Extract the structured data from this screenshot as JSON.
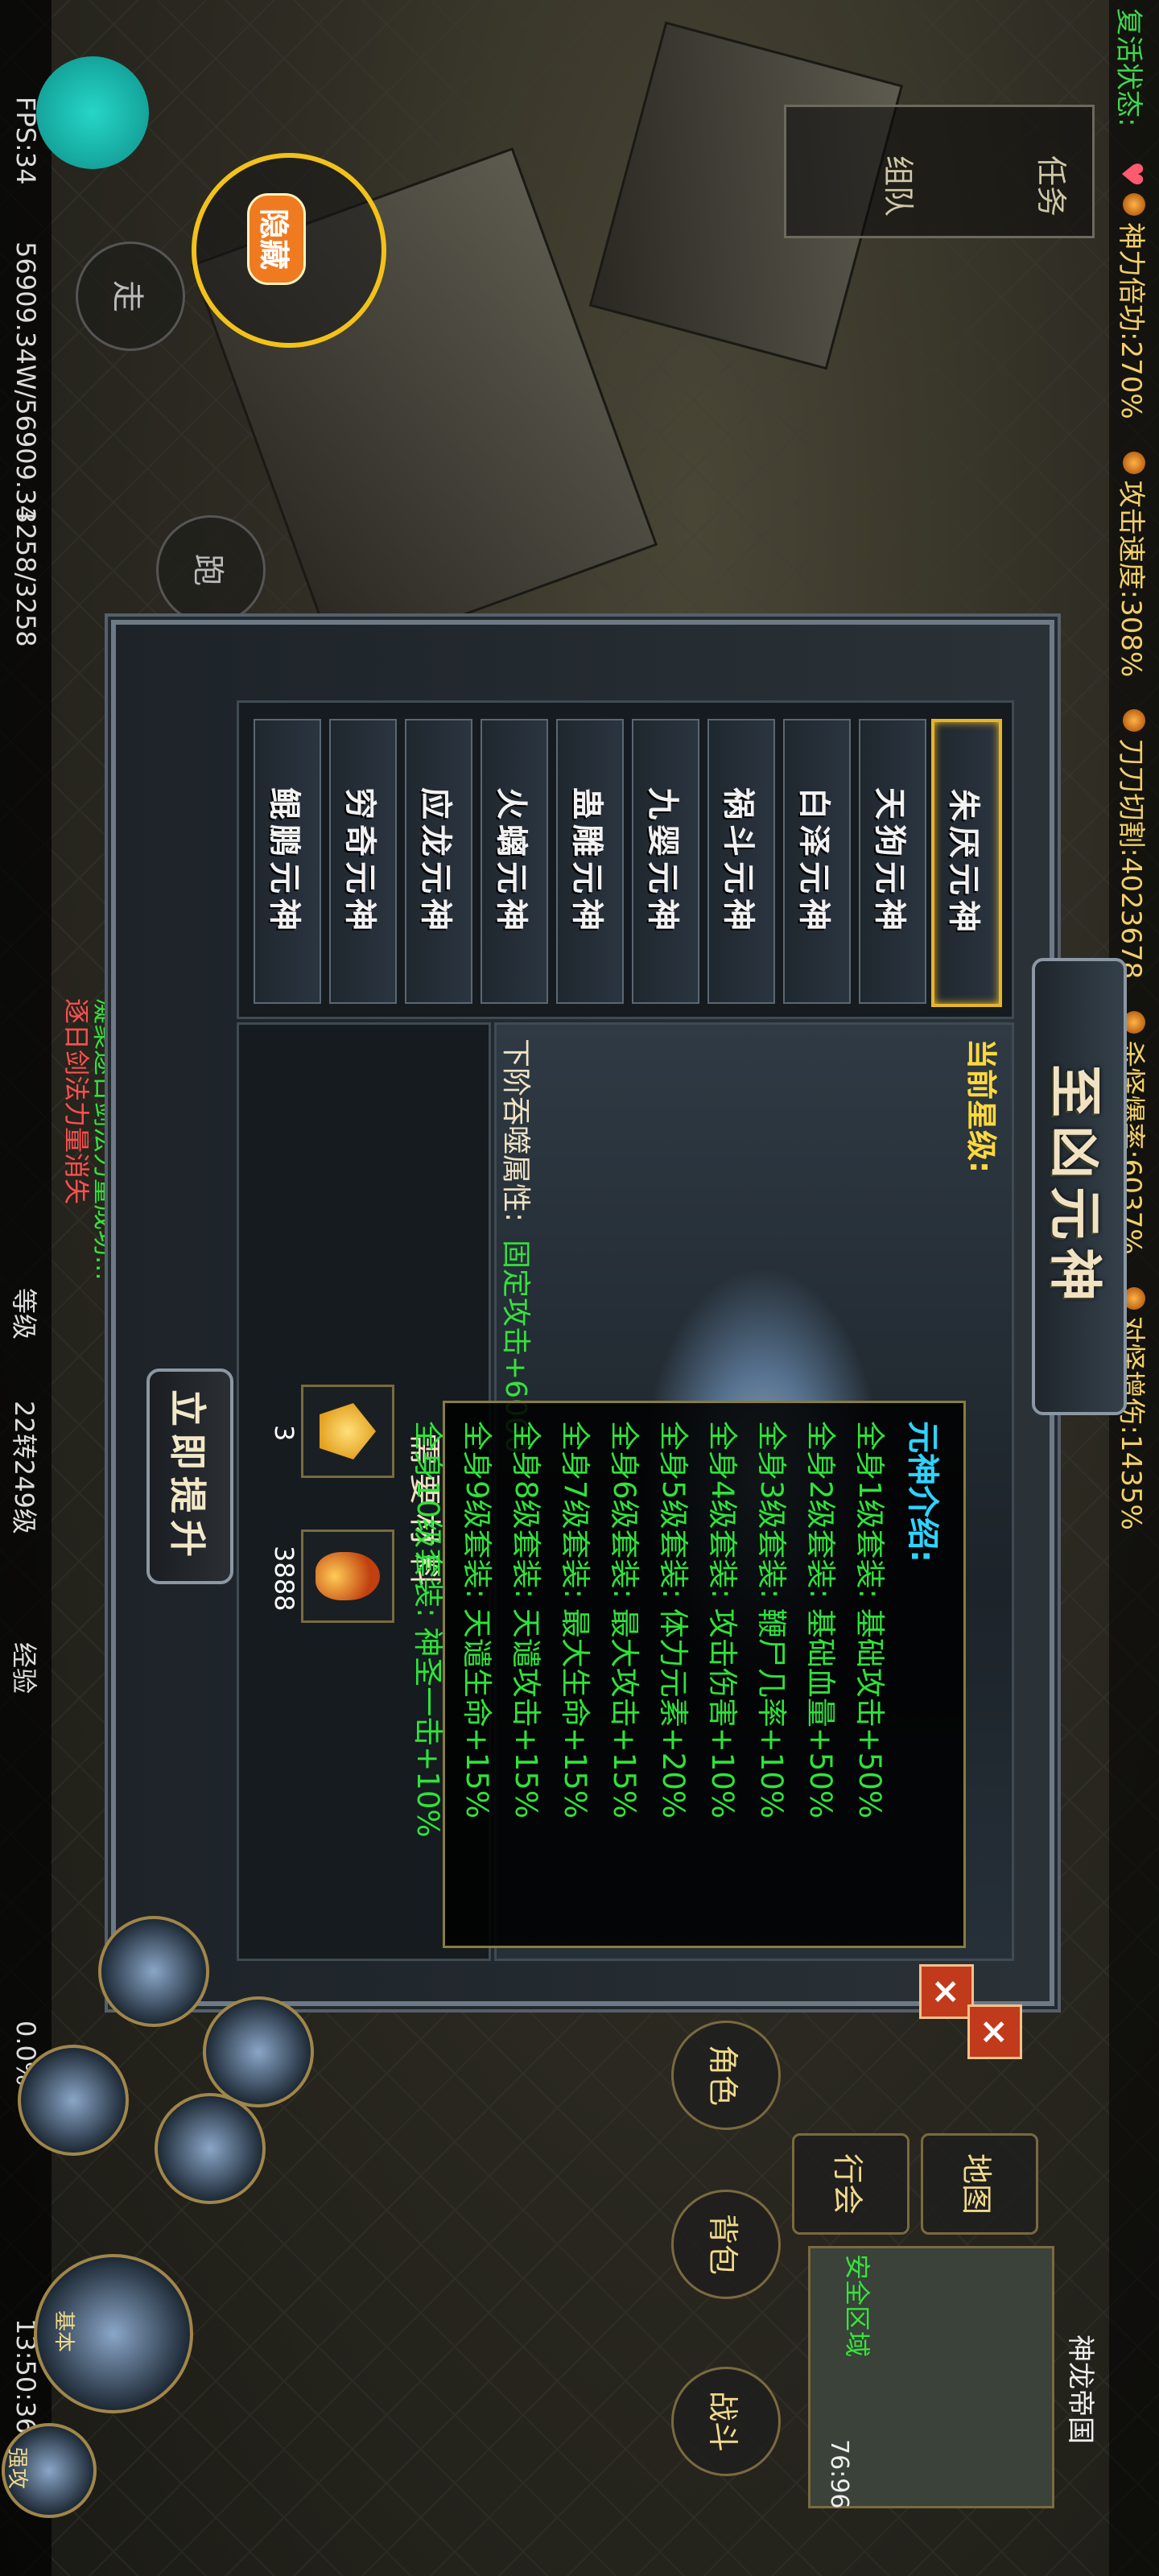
{
  "status": {
    "revive": "复活状态:",
    "stats": [
      "神力倍功:270%",
      "攻击速度:308%",
      "刀刀切割:4023678",
      "杀怪爆率:6037%",
      "对怪增伤:1435%"
    ]
  },
  "bottom": {
    "fps": "FPS:34",
    "mp": "56909.34W/56909.34",
    "hp": "3258/3258",
    "level_label": "等级",
    "level": "22转249级",
    "exp_label": "经验",
    "exp": "0.0%",
    "time": "13:50:36"
  },
  "chat": {
    "line1": "逐日剑法力量消失",
    "line2": "凝聚逐日剑法力量成功..."
  },
  "panel": {
    "title": "至凶元神",
    "current_star_label": "当前星级:",
    "next_attr_label": "下阶吞噬属性:",
    "next_attr_value": "固定攻击+6000",
    "materials_title": "需要材料",
    "materials": [
      {
        "name": "gold-gem",
        "count": "3"
      },
      {
        "name": "fire-material",
        "count": "3888"
      }
    ],
    "upgrade_label": "立即提升",
    "tabs": [
      "朱厌元神",
      "天狗元神",
      "白泽元神",
      "祸斗元神",
      "九婴元神",
      "蛊雕元神",
      "火螭元神",
      "应龙元神",
      "穷奇元神",
      "鲲鹏元神"
    ],
    "active_tab": 0
  },
  "info": {
    "title": "元神介绍:",
    "lines": [
      "全身1级套装: 基础攻击+50%",
      "全身2级套装: 基础血量+50%",
      "全身3级套装: 鞭尸几率+10%",
      "全身4级套装: 攻击伤害+10%",
      "全身5级套装: 体力元素+20%",
      "全身6级套装: 最大攻击+15%",
      "全身7级套装: 最大生命+15%",
      "全身8级套装: 天谴攻击+15%",
      "全身9级套装: 天谴生命+15%",
      "全身10级套装: 神圣一击+10%"
    ]
  },
  "hud": {
    "hide_label": "隐藏",
    "walk_label": "走",
    "run_label": "跑",
    "task_label": "任务",
    "team_label": "组队",
    "map_button": "地图",
    "guild_button": "行会",
    "map_name": "神龙帝国",
    "safe_zone": "安全区域",
    "coords": "76:96",
    "action_buttons": [
      "角色",
      "背包",
      "战斗"
    ],
    "skills": [
      "基本",
      "强攻"
    ]
  }
}
